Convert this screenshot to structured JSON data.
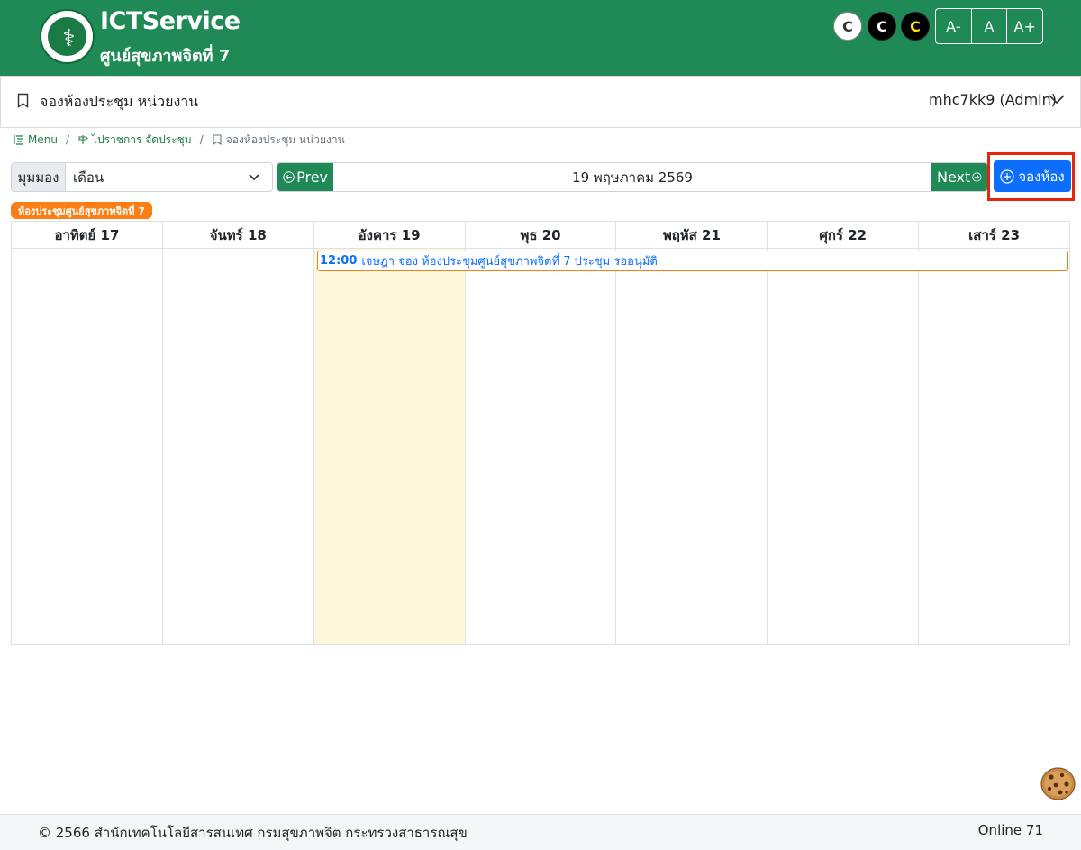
{
  "header": {
    "brand_title": "ICTService",
    "brand_subtitle": "ศูนย์สุขภาพจิตที่ 7",
    "contrast_buttons": [
      "C",
      "C",
      "C"
    ],
    "font_size_buttons": [
      "A-",
      "A",
      "A+"
    ],
    "colors": {
      "bg": "#1f8a55",
      "text": "#ffffff"
    }
  },
  "titlebar": {
    "page_title": "จองห้องประชุม หน่วยงาน",
    "user": "mhc7kk9 (Admin)"
  },
  "breadcrumb": {
    "items": [
      "Menu",
      "ไปราชการ จัดประชุม",
      "จองห้องประชุม หน่วยงาน"
    ]
  },
  "toolbar": {
    "view_label": "มุมมอง",
    "view_value": "เดือน",
    "prev_label": "Prev",
    "current_date": "19 พฤษภาคม 2569",
    "next_label": "Next",
    "book_label": "จองห้อง"
  },
  "room_badge": "ห้องประชุมศูนย์สุขภาพจิตที่ 7",
  "calendar": {
    "days": [
      "อาทิตย์ 17",
      "จันทร์ 18",
      "อังคาร 19",
      "พุธ 20",
      "พฤหัส 21",
      "ศุกร์ 22",
      "เสาร์ 23"
    ],
    "today_index": 2,
    "event": {
      "time": "12:00",
      "text": "เจษฎา จอง ห้องประชุมศูนย์สุขภาพจิตที่ 7 ประชุม รออนุมัติ"
    }
  },
  "footer": {
    "copyright": "© 2566 สำนักเทคโนโลยีสารสนเทศ กรมสุขภาพจิต กระทรวงสาธารณสุข",
    "online": "Online 71"
  }
}
